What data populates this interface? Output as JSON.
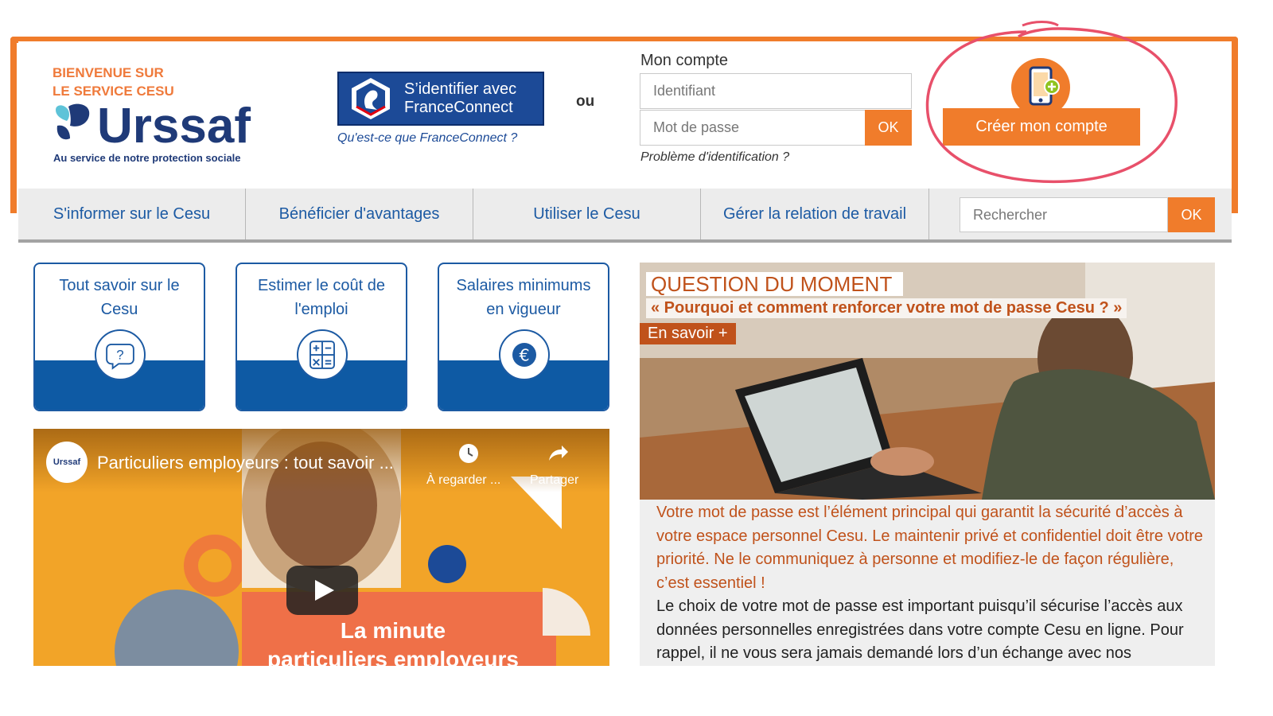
{
  "header": {
    "welcome_line1": "BIENVENUE SUR",
    "welcome_line2": "LE SERVICE CESU",
    "logo_word": "Urssaf",
    "logo_tagline": "Au service de notre protection sociale",
    "franceconnect_line1": "S’identifier avec",
    "franceconnect_line2": "FranceConnect",
    "franceconnect_link": "Qu'est-ce que FranceConnect ?",
    "or_label": "ou",
    "account_label": "Mon compte",
    "identifier_placeholder": "Identifiant",
    "password_placeholder": "Mot de passe",
    "ok_label": "OK",
    "problem_link": "Problème d'identification ?",
    "create_account_label": "Créer mon compte"
  },
  "nav": {
    "items": [
      {
        "label": "S'informer sur le Cesu"
      },
      {
        "label": "Bénéficier d'avantages"
      },
      {
        "label": "Utiliser le Cesu"
      },
      {
        "label": "Gérer la relation de travail"
      }
    ],
    "search_placeholder": "Rechercher",
    "search_ok": "OK"
  },
  "tiles": [
    {
      "label": "Tout savoir sur le Cesu",
      "icon": "question-icon"
    },
    {
      "label": "Estimer le coût de l'emploi",
      "icon": "calculator-icon"
    },
    {
      "label": "Salaires minimums en vigueur",
      "icon": "euro-icon"
    }
  ],
  "video": {
    "channel": "Urssaf",
    "title": "Particuliers employeurs : tout savoir ...",
    "watch_later": "À regarder ...",
    "share": "Partager",
    "caption_line1": "La minute",
    "caption_line2": "particuliers employeurs"
  },
  "question": {
    "heading": "QUESTION DU MOMENT",
    "question": "« Pourquoi et comment renforcer votre mot de passe Cesu ? »",
    "more_link": "En savoir +",
    "intro": "Votre mot de passe est l’élément principal qui garantit la sécurité d’accès à votre espace personnel Cesu. Le maintenir privé et confidentiel doit être votre priorité. Ne le communiquez à personne et modifiez-le de façon régulière, c’est essentiel !",
    "body": "Le choix de votre mot de passe est important puisqu’il sécurise l’accès aux données personnelles enregistrées dans votre compte Cesu en ligne. Pour rappel, il ne vous sera jamais demandé lors d’un échange avec nos"
  },
  "colors": {
    "orange": "#f07c2b",
    "blue": "#1c5aa3",
    "dark_blue": "#1f3a78",
    "rust": "#c0521b",
    "annotation_red": "#e8506a"
  }
}
